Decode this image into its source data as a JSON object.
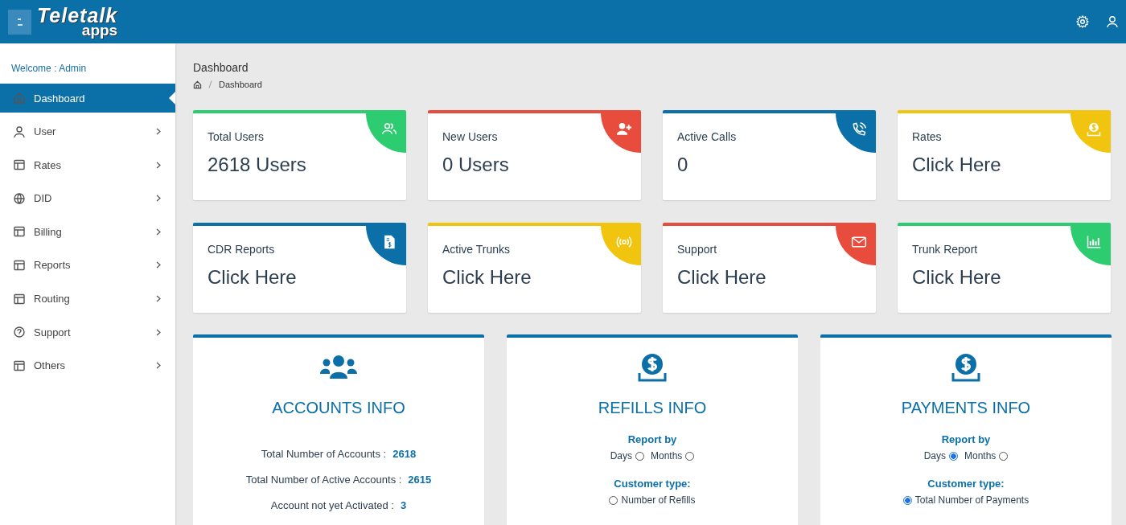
{
  "header": {
    "logo_title": "Teletalk",
    "logo_subtitle": "apps"
  },
  "sidebar": {
    "welcome": "Welcome : Admin",
    "items": [
      {
        "label": "Dashboard",
        "selected": true,
        "expandable": false
      },
      {
        "label": "User",
        "selected": false,
        "expandable": true
      },
      {
        "label": "Rates",
        "selected": false,
        "expandable": true
      },
      {
        "label": "DID",
        "selected": false,
        "expandable": true
      },
      {
        "label": "Billing",
        "selected": false,
        "expandable": true
      },
      {
        "label": "Reports",
        "selected": false,
        "expandable": true
      },
      {
        "label": "Routing",
        "selected": false,
        "expandable": true
      },
      {
        "label": "Support",
        "selected": false,
        "expandable": true
      },
      {
        "label": "Others",
        "selected": false,
        "expandable": true
      }
    ]
  },
  "page_title": "Dashboard",
  "breadcrumb": [
    "Dashboard"
  ],
  "stat_cards": [
    {
      "title": "Total Users",
      "value": "2618 Users",
      "color": "#2ecc71"
    },
    {
      "title": "New Users",
      "value": "0 Users",
      "color": "#e74c3c"
    },
    {
      "title": "Active Calls",
      "value": "0",
      "color": "#0b6fa8"
    },
    {
      "title": "Rates",
      "value": "Click Here",
      "color": "#f1c40f"
    },
    {
      "title": "CDR Reports",
      "value": "Click Here",
      "color": "#0b6fa8"
    },
    {
      "title": "Active Trunks",
      "value": "Click Here",
      "color": "#f1c40f"
    },
    {
      "title": "Support",
      "value": "Click Here",
      "color": "#e74c3c"
    },
    {
      "title": "Trunk Report",
      "value": "Click Here",
      "color": "#2ecc71"
    }
  ],
  "info_panels": [
    {
      "kind": "stats",
      "title": "ACCOUNTS INFO",
      "rows": [
        {
          "label": "Total Number of Accounts  :",
          "value": "2618"
        },
        {
          "label": "Total Number of Active Accounts :",
          "value": "2615"
        },
        {
          "label": "Account not yet Activated :",
          "value": "3"
        }
      ]
    },
    {
      "kind": "report",
      "title": "REFILLS INFO",
      "report_by_label": "Report by",
      "report_by": [
        {
          "label": "Days",
          "selected": false
        },
        {
          "label": "Months",
          "selected": false
        }
      ],
      "customer_type_label": "Customer type:",
      "customer_types": [
        {
          "label": "Number of Refills",
          "selected": false
        }
      ]
    },
    {
      "kind": "report",
      "title": "PAYMENTS INFO",
      "report_by_label": "Report by",
      "report_by": [
        {
          "label": "Days",
          "selected": true
        },
        {
          "label": "Months",
          "selected": false
        }
      ],
      "customer_type_label": "Customer type:",
      "customer_types": [
        {
          "label": "Total Number of Payments",
          "selected": true
        }
      ]
    }
  ]
}
